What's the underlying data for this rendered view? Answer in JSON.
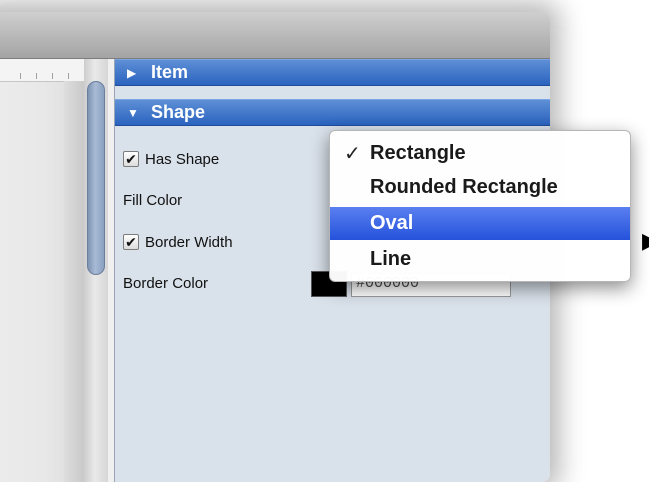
{
  "inspector": {
    "sections": [
      {
        "label": "Item",
        "expanded": false
      },
      {
        "label": "Shape",
        "expanded": true
      }
    ],
    "rows": {
      "has_shape": {
        "label": "Has Shape",
        "checked": true
      },
      "fill_color": {
        "label": "Fill Color"
      },
      "border_width": {
        "label": "Border Width",
        "checked": true
      },
      "border_color": {
        "label": "Border Color",
        "value": "#000000"
      }
    }
  },
  "shape_menu": {
    "items": [
      {
        "label": "Rectangle",
        "checked": true
      },
      {
        "label": "Rounded Rectangle",
        "checked": false
      },
      {
        "label": "Oval",
        "highlighted": true
      },
      {
        "label": "Line",
        "checked": false
      }
    ],
    "check_glyph": "✓"
  },
  "colors": {
    "header_blue": "#2a63bf",
    "highlight_blue": "#2452db",
    "panel_bg": "#d9e1ea"
  }
}
